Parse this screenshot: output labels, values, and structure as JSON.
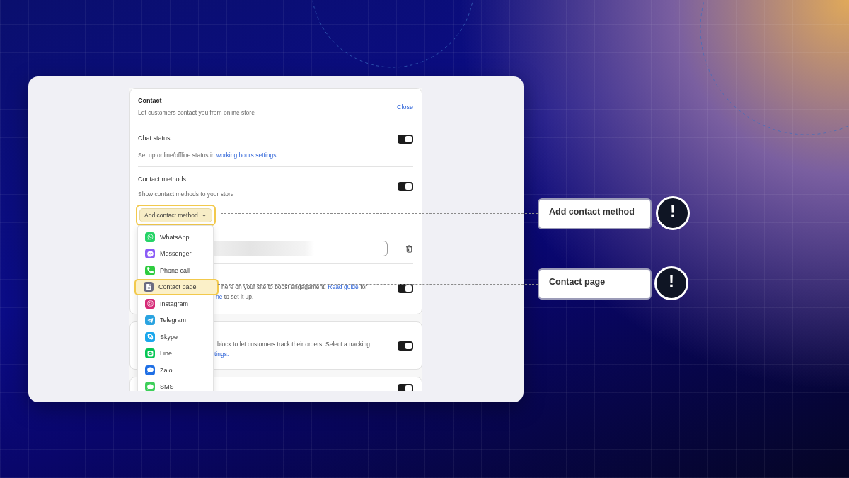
{
  "contact": {
    "title": "Contact",
    "subtitle": "Let customers contact you from online store",
    "close_link": "Close"
  },
  "chat_status": {
    "label": "Chat status",
    "on": true,
    "hint": "Set up online/offline status in",
    "hint_link": "working hours settings"
  },
  "contact_methods": {
    "label": "Contact methods",
    "hint": "Show contact methods to your store",
    "on": true,
    "add_button": "Add contact method",
    "highlighted": true
  },
  "menu": [
    {
      "label": "WhatsApp",
      "color": "#25d366",
      "highlighted": false
    },
    {
      "label": "Messenger",
      "color": "#8b5cf6",
      "highlighted": false
    },
    {
      "label": "Phone call",
      "color": "#2ecc40",
      "highlighted": false
    },
    {
      "label": "Contact page",
      "color": "#6b6b80",
      "highlighted": true
    },
    {
      "label": "Instagram",
      "color": "#d62976",
      "highlighted": false
    },
    {
      "label": "Telegram",
      "color": "#2aa3e0",
      "highlighted": false
    },
    {
      "label": "Skype",
      "color": "#1aa7ec",
      "highlighted": false
    },
    {
      "label": "Line",
      "color": "#06c755",
      "highlighted": false
    },
    {
      "label": "Zalo",
      "color": "#1f6fe5",
      "highlighted": false
    },
    {
      "label": "SMS",
      "color": "#3ecf5a",
      "highlighted": false
    }
  ],
  "cut_row_1": {
    "line_1": "here on your site to boost engagement.",
    "line_1_link": "Read guide",
    "line_1_end": "for",
    "line_2_link": "ne",
    "line_2": "to set it up.",
    "on": true
  },
  "cut_row_2": {
    "line_1": "block to let customers track their orders. Select a tracking",
    "line_2_link": "tings.",
    "on": true
  },
  "cut_row_3": {
    "on": true
  },
  "callouts": [
    {
      "label": "Add contact method",
      "mark": "!"
    },
    {
      "label": "Contact page",
      "mark": "!"
    }
  ]
}
